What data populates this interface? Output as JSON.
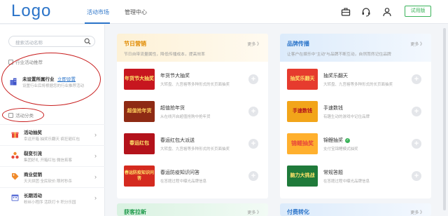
{
  "header": {
    "logo": "Logo",
    "tabs": [
      {
        "label": "活动市场"
      },
      {
        "label": "管理中心"
      }
    ],
    "trial_label": "试用版"
  },
  "sidebar": {
    "search_placeholder": "搜索活动名称",
    "recommend_title": "行业活动推荐",
    "industry_label": "未设置所属行业",
    "industry_link": "立即设置",
    "industry_desc": "设置行业后将根据您的行业推荐活动",
    "category_title": "活动分类",
    "categories": [
      {
        "name": "活动抽奖",
        "sub": "幸运开箱  抽奖乐翻天  疯狂砸红包"
      },
      {
        "name": "裂变引流",
        "sub": "集团好礼  开箱红包  微信拓客"
      },
      {
        "name": "商业促销",
        "sub": "天天拼团  全民砍价  限时秒杀"
      },
      {
        "name": "长期活动",
        "sub": "粉丝小程序  活跃打卡  积分乐园"
      }
    ]
  },
  "panels": [
    {
      "title": "节日营销",
      "more": "更多 》",
      "desc": "节日自带流量属性，降低传播成本，提高效率",
      "items": [
        {
          "name": "年货节大抽奖",
          "desc": "大转盘、九宫格等多种形式的长页面抽奖",
          "thumb": "年货节大抽奖"
        },
        {
          "name": "超值抢年货",
          "desc": "从在线开启超值抢购中抢年货",
          "thumb": "超值抢年货"
        },
        {
          "name": "春运红包大派送",
          "desc": "大转盘、九宫格等多种形式的长页面抽奖",
          "thumb": "春运红包"
        },
        {
          "name": "春运防疫知识问答",
          "desc": "在答题过程中曝光品牌信息",
          "thumb": "春运防疫知识问答"
        }
      ]
    },
    {
      "title": "品牌传播",
      "more": "更多 》",
      "desc": "让客户在娱乐中“主动”与品牌不断互动，自然而然记住品牌",
      "items": [
        {
          "name": "抽奖乐翻天",
          "desc": "大转盘、九宫格等多种形式的长页面抽奖",
          "thumb": "抽奖乐翻天",
          "verified": false
        },
        {
          "name": "手速数钱",
          "desc": "有趣生动的游戏中记住品牌",
          "thumb": "手速数钱",
          "verified": false
        },
        {
          "name": "锦鲤抽奖",
          "desc": "支付宝锦鲤模式抽奖",
          "thumb": "锦鲤抽奖",
          "verified": true
        },
        {
          "name": "常规答题",
          "desc": "在答题过程中曝光品牌信息",
          "thumb": "脑力大挑战",
          "verified": false
        }
      ]
    }
  ],
  "lower_panels": [
    {
      "title": "获客拉新",
      "more": "更多 》"
    },
    {
      "title": "付费转化",
      "more": "更多 》"
    }
  ],
  "colors": {
    "brand": "#2b74c9",
    "accent_green": "#3bb35a",
    "annotation_red": "#c81e1e"
  }
}
